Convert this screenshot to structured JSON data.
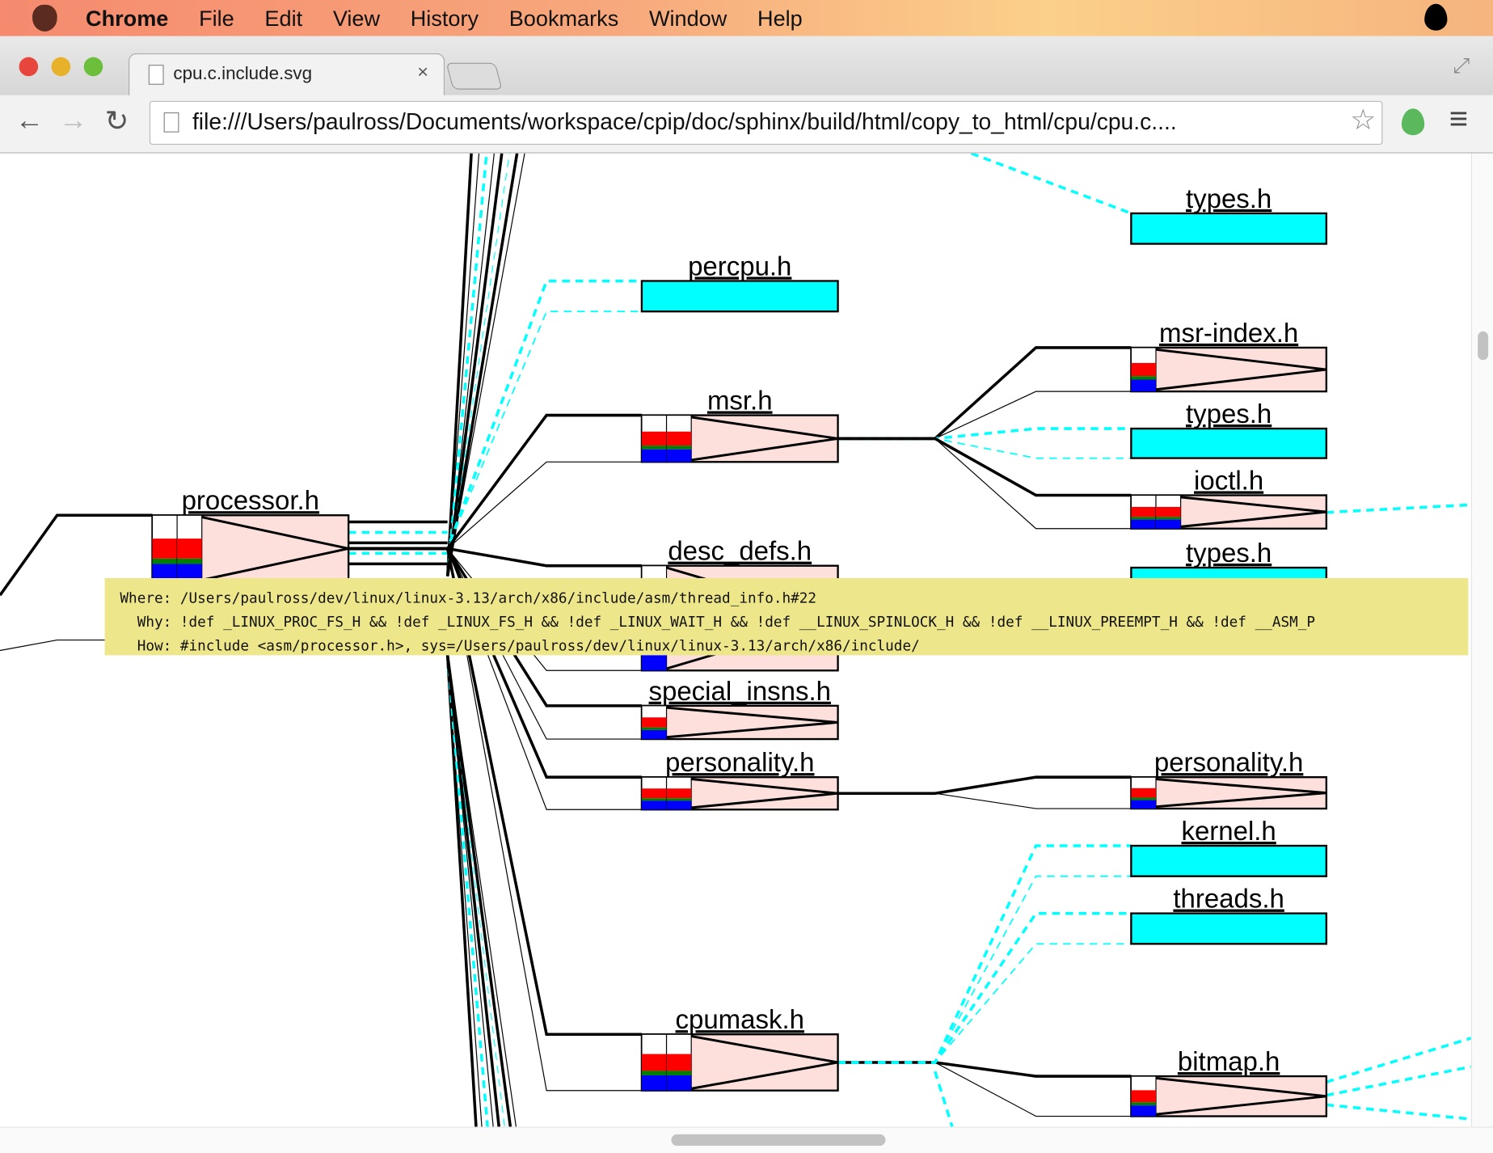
{
  "menubar": {
    "app": "Chrome",
    "items": [
      "File",
      "Edit",
      "View",
      "History",
      "Bookmarks",
      "Window",
      "Help"
    ]
  },
  "tab": {
    "title": "cpu.c.include.svg",
    "close": "×"
  },
  "toolbar": {
    "url": "file:///Users/paulross/Documents/workspace/cpip/doc/sphinx/build/html/copy_to_html/cpu/cpu.c....",
    "back": "←",
    "forward": "→",
    "reload": "↻",
    "star": "☆",
    "menu": "≡"
  },
  "graph": {
    "colors": {
      "node_fill": "#fde0dc",
      "cyan": "#00ffff",
      "red": "#ff0000",
      "blue": "#0000ff",
      "green": "#008000"
    },
    "nodes": [
      "processor.h",
      "percpu.h",
      "msr.h",
      "desc_defs.h",
      "special_insns.h",
      "personality.h",
      "cpumask.h",
      "types.h",
      "msr-index.h",
      "types.h",
      "ioctl.h",
      "types.h",
      "personality.h",
      "kernel.h",
      "threads.h",
      "bitmap.h"
    ]
  },
  "tooltip": {
    "where": "Where: /Users/paulross/dev/linux/linux-3.13/arch/x86/include/asm/thread_info.h#22",
    "why": "  Why: !def _LINUX_PROC_FS_H && !def _LINUX_FS_H && !def _LINUX_WAIT_H && !def __LINUX_SPINLOCK_H && !def __LINUX_PREEMPT_H && !def __ASM_P",
    "how": "  How: #include <asm/processor.h>, sys=/Users/paulross/dev/linux/linux-3.13/arch/x86/include/"
  }
}
